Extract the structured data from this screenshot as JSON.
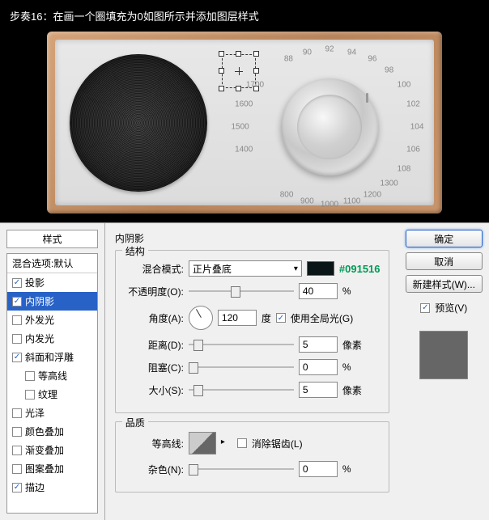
{
  "caption": "步奏16：在画一个圈填充为0如图所示并添加图层样式",
  "dial_labels": [
    "88",
    "90",
    "92",
    "94",
    "96",
    "98",
    "100",
    "102",
    "104",
    "106",
    "108",
    "1000",
    "1100",
    "1200",
    "1300",
    "1400",
    "1500",
    "1600",
    "1700",
    "800",
    "900"
  ],
  "styles": {
    "panel_title": "样式",
    "header": "混合选项:默认",
    "items": [
      {
        "label": "投影",
        "checked": true
      },
      {
        "label": "内阴影",
        "checked": true,
        "selected": true
      },
      {
        "label": "外发光",
        "checked": false
      },
      {
        "label": "内发光",
        "checked": false
      },
      {
        "label": "斜面和浮雕",
        "checked": true
      },
      {
        "label": "等高线",
        "checked": false,
        "indent": true
      },
      {
        "label": "纹理",
        "checked": false,
        "indent": true
      },
      {
        "label": "光泽",
        "checked": false
      },
      {
        "label": "颜色叠加",
        "checked": false
      },
      {
        "label": "渐变叠加",
        "checked": false
      },
      {
        "label": "图案叠加",
        "checked": false
      },
      {
        "label": "描边",
        "checked": true
      }
    ]
  },
  "inner_shadow": {
    "title": "内阴影",
    "structure_label": "结构",
    "blend_mode_label": "混合模式:",
    "blend_mode_value": "正片叠底",
    "color_hex": "#091516",
    "opacity_label": "不透明度(O):",
    "opacity_value": "40",
    "opacity_unit": "%",
    "angle_label": "角度(A):",
    "angle_value": "120",
    "angle_unit": "度",
    "global_light_label": "使用全局光(G)",
    "global_light_checked": true,
    "distance_label": "距离(D):",
    "distance_value": "5",
    "distance_unit": "像素",
    "choke_label": "阻塞(C):",
    "choke_value": "0",
    "choke_unit": "%",
    "size_label": "大小(S):",
    "size_value": "5",
    "size_unit": "像素",
    "quality_label": "品质",
    "contour_label": "等高线:",
    "antialias_label": "消除锯齿(L)",
    "antialias_checked": false,
    "noise_label": "杂色(N):",
    "noise_value": "0",
    "noise_unit": "%"
  },
  "buttons": {
    "ok": "确定",
    "cancel": "取消",
    "new_style": "新建样式(W)...",
    "preview_label": "预览(V)",
    "preview_checked": true
  }
}
